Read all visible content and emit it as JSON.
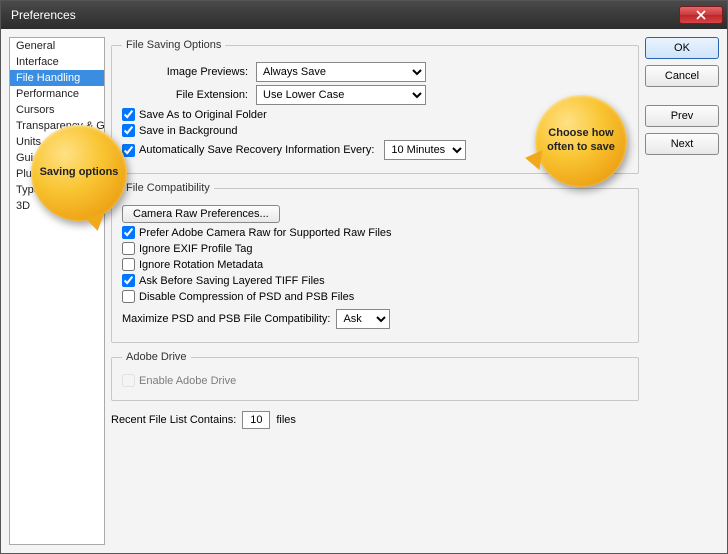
{
  "window": {
    "title": "Preferences"
  },
  "sidebar": {
    "items": [
      {
        "label": "General"
      },
      {
        "label": "Interface"
      },
      {
        "label": "File Handling",
        "selected": true
      },
      {
        "label": "Performance"
      },
      {
        "label": "Cursors"
      },
      {
        "label": "Transparency & Gamut"
      },
      {
        "label": "Units & Rulers"
      },
      {
        "label": "Guides, Grid & Slices"
      },
      {
        "label": "Plug-Ins"
      },
      {
        "label": "Type"
      },
      {
        "label": "3D"
      }
    ]
  },
  "buttons": {
    "ok": "OK",
    "cancel": "Cancel",
    "prev": "Prev",
    "next": "Next"
  },
  "fso": {
    "legend": "File Saving Options",
    "image_previews_label": "Image Previews:",
    "image_previews_value": "Always Save",
    "file_extension_label": "File Extension:",
    "file_extension_value": "Use Lower Case",
    "save_as_orig": {
      "label": "Save As to Original Folder",
      "checked": true
    },
    "save_bg": {
      "label": "Save in Background",
      "checked": true
    },
    "autosave": {
      "label": "Automatically Save Recovery Information Every:",
      "checked": true,
      "value": "10 Minutes"
    }
  },
  "fc": {
    "legend": "File Compatibility",
    "camera_raw_btn": "Camera Raw Preferences...",
    "prefer_acr": {
      "label": "Prefer Adobe Camera Raw for Supported Raw Files",
      "checked": true
    },
    "ignore_exif": {
      "label": "Ignore EXIF Profile Tag",
      "checked": false
    },
    "ignore_rot": {
      "label": "Ignore Rotation Metadata",
      "checked": false
    },
    "ask_tiff": {
      "label": "Ask Before Saving Layered TIFF Files",
      "checked": true
    },
    "disable_comp": {
      "label": "Disable Compression of PSD and PSB Files",
      "checked": false
    },
    "maximize_label": "Maximize PSD and PSB File Compatibility:",
    "maximize_value": "Ask"
  },
  "drive": {
    "legend": "Adobe Drive",
    "enable": {
      "label": "Enable Adobe Drive",
      "checked": false,
      "disabled": true
    }
  },
  "recent": {
    "label_before": "Recent File List Contains:",
    "value": "10",
    "label_after": "files"
  },
  "callouts": {
    "left": "Saving options",
    "right": "Choose how\noften to save"
  }
}
